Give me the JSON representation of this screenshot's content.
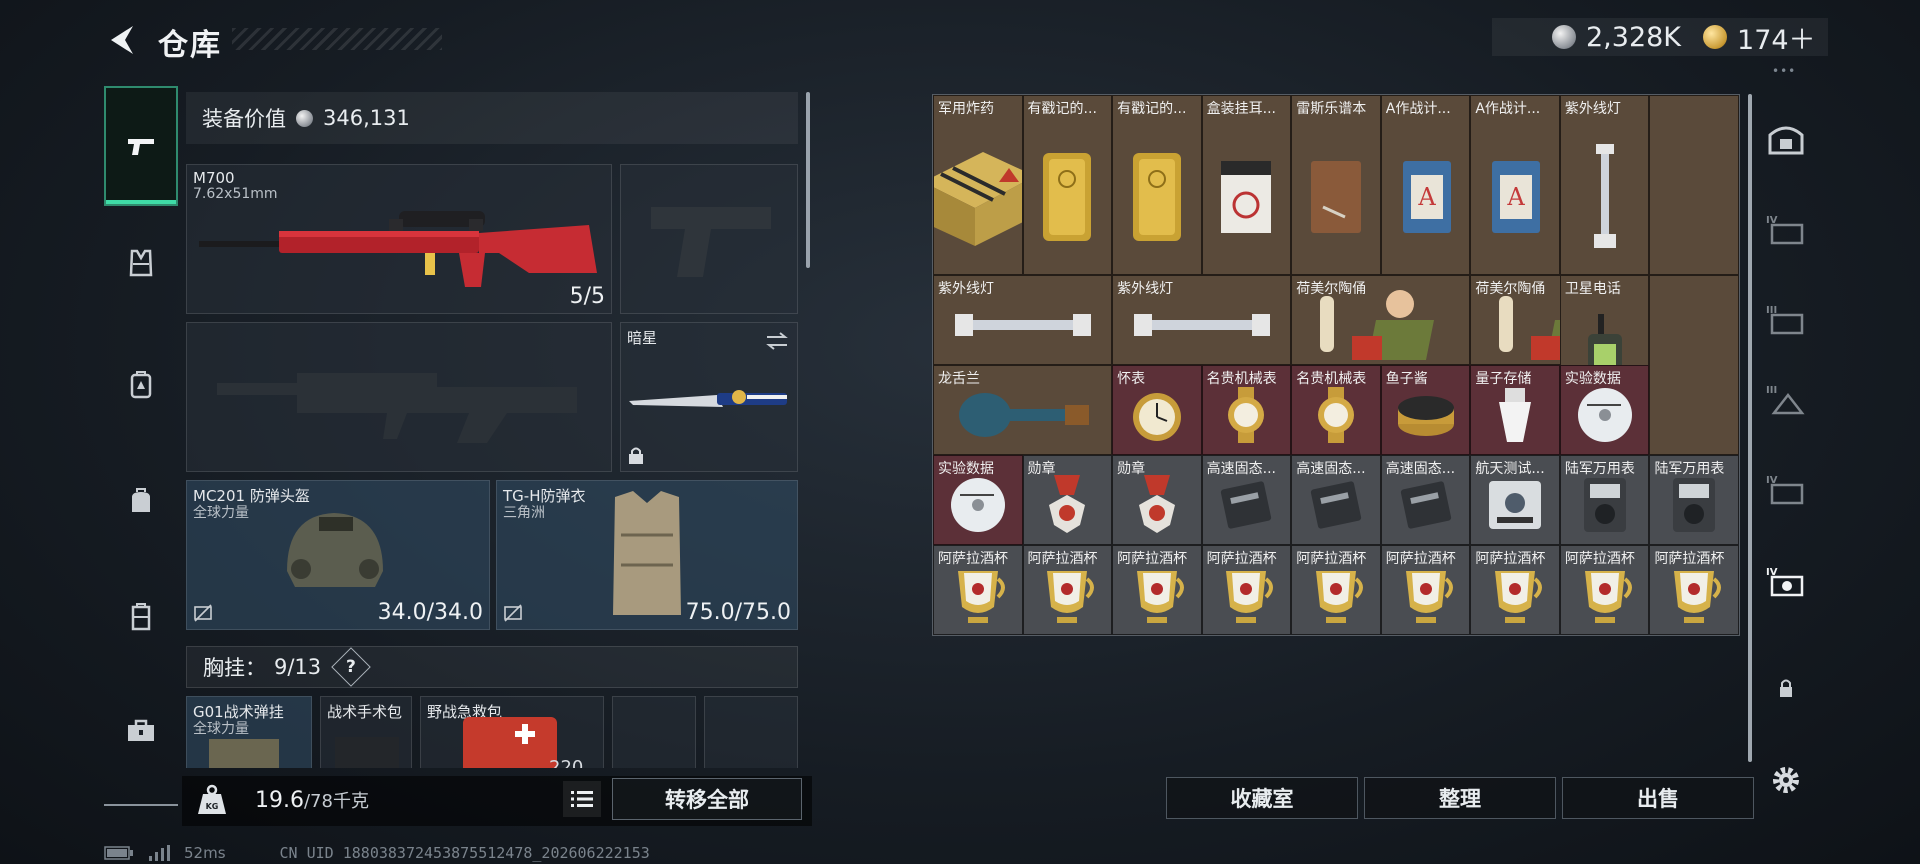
{
  "header": {
    "title": "仓库",
    "currency_silver": "2,328K",
    "currency_gold": "174＋",
    "menu_dots": "•••"
  },
  "nav": {
    "items": [
      {
        "name": "weapons",
        "icon": "pistol-icon",
        "active": true
      },
      {
        "name": "chest-rig",
        "icon": "vest-icon"
      },
      {
        "name": "backpack",
        "icon": "backpack-icon"
      },
      {
        "name": "bag",
        "icon": "bag-icon"
      },
      {
        "name": "case",
        "icon": "container-icon"
      },
      {
        "name": "toolbox",
        "icon": "toolbox-icon"
      }
    ]
  },
  "equipment": {
    "value_label": "装备价值",
    "value": "346,131",
    "primary_weapon": {
      "name": "M700",
      "caliber": "7.62x51mm",
      "ammo": "5/5"
    },
    "melee": {
      "name": "暗星"
    },
    "helmet": {
      "name": "MC201 防弹头盔",
      "sub": "全球力量",
      "durability": "34.0/34.0"
    },
    "armor": {
      "name": "TG-H防弹衣",
      "sub": "三角洲",
      "durability": "75.0/75.0"
    },
    "chest_label": "胸挂：",
    "chest_count": "9/13",
    "chest_help": "?",
    "chest_items": [
      {
        "name": "G01战术弹挂",
        "sub": "全球力量"
      },
      {
        "name": "战术手术包"
      },
      {
        "name": "野战急救包",
        "count": "220"
      }
    ]
  },
  "footer_left": {
    "weight_current": "19.6",
    "weight_max": "/78千克",
    "transfer_all": "转移全部",
    "ping": "52ms",
    "uid": "CN UID 1880383724538755124​78_202606222153"
  },
  "storage": {
    "row1": [
      {
        "label": "军用炸药",
        "color": "brown",
        "art": "crate"
      },
      {
        "label": "有戳记的...",
        "color": "brown",
        "art": "gold-bar"
      },
      {
        "label": "有戳记的...",
        "color": "brown",
        "art": "gold-bar"
      },
      {
        "label": "盒装挂耳...",
        "color": "brown",
        "art": "coffee-box"
      },
      {
        "label": "雷斯乐谱本",
        "color": "brown",
        "art": "notebook"
      },
      {
        "label": "A作战计...",
        "color": "brown",
        "art": "plan-book"
      },
      {
        "label": "A作战计...",
        "color": "brown",
        "art": "plan-book"
      },
      {
        "label": "紫外线灯",
        "color": "brown",
        "art": "uv-lamp-v"
      }
    ],
    "row2": [
      {
        "label": "紫外线灯",
        "color": "brown",
        "art": "uv-lamp-h"
      },
      {
        "label": "紫外线灯",
        "color": "brown",
        "art": "uv-lamp-h"
      },
      {
        "label": "荷美尔陶俑",
        "color": "brown",
        "art": "figurine"
      },
      {
        "label": "荷美尔陶俑",
        "color": "brown",
        "art": "figurine"
      },
      {
        "label": "卫星电话",
        "color": "brown",
        "art": "sat-phone"
      }
    ],
    "row3": [
      {
        "label": "龙舌兰",
        "color": "brown",
        "art": "bottle"
      },
      {
        "label": "怀表",
        "color": "maroon",
        "art": "pocket-watch"
      },
      {
        "label": "名贵机械表",
        "color": "maroon",
        "art": "wristwatch"
      },
      {
        "label": "名贵机械表",
        "color": "maroon",
        "art": "wristwatch"
      },
      {
        "label": "鱼子酱",
        "color": "maroon",
        "art": "caviar"
      },
      {
        "label": "量子存储",
        "color": "maroon",
        "art": "usb"
      },
      {
        "label": "实验数据",
        "color": "maroon",
        "art": "disc"
      }
    ],
    "row4": [
      {
        "label": "实验数据",
        "color": "maroon",
        "art": "disc"
      },
      {
        "label": "勋章",
        "color": "grey",
        "art": "medal"
      },
      {
        "label": "勋章",
        "color": "grey",
        "art": "medal"
      },
      {
        "label": "高速固态...",
        "color": "grey",
        "art": "ssd"
      },
      {
        "label": "高速固态...",
        "color": "grey",
        "art": "ssd"
      },
      {
        "label": "高速固态...",
        "color": "grey",
        "art": "ssd"
      },
      {
        "label": "航天测试...",
        "color": "grey",
        "art": "device"
      },
      {
        "label": "陆军万用表",
        "color": "grey",
        "art": "multimeter"
      },
      {
        "label": "陆军万用表",
        "color": "grey",
        "art": "multimeter"
      }
    ],
    "row5": [
      {
        "label": "阿萨拉酒杯",
        "color": "grey",
        "art": "cup"
      },
      {
        "label": "阿萨拉酒杯",
        "color": "grey",
        "art": "cup"
      },
      {
        "label": "阿萨拉酒杯",
        "color": "grey",
        "art": "cup"
      },
      {
        "label": "阿萨拉酒杯",
        "color": "grey",
        "art": "cup"
      },
      {
        "label": "阿萨拉酒杯",
        "color": "grey",
        "art": "cup"
      },
      {
        "label": "阿萨拉酒杯",
        "color": "grey",
        "art": "cup"
      },
      {
        "label": "阿萨拉酒杯",
        "color": "grey",
        "art": "cup"
      },
      {
        "label": "阿萨拉酒杯",
        "color": "grey",
        "art": "cup"
      },
      {
        "label": "阿萨拉酒杯",
        "color": "grey",
        "art": "cup"
      }
    ]
  },
  "right_tabs": {
    "labels": [
      "",
      "IV",
      "III",
      "III",
      "IV",
      "IV",
      "",
      ""
    ]
  },
  "footer_right": {
    "collection": "收藏室",
    "organize": "整理",
    "sell": "出售"
  },
  "colors": {
    "accent": "#3fdba6",
    "cell_brown": "#5a4a3a",
    "cell_maroon": "#5c3038",
    "cell_grey": "#4a4d52"
  }
}
